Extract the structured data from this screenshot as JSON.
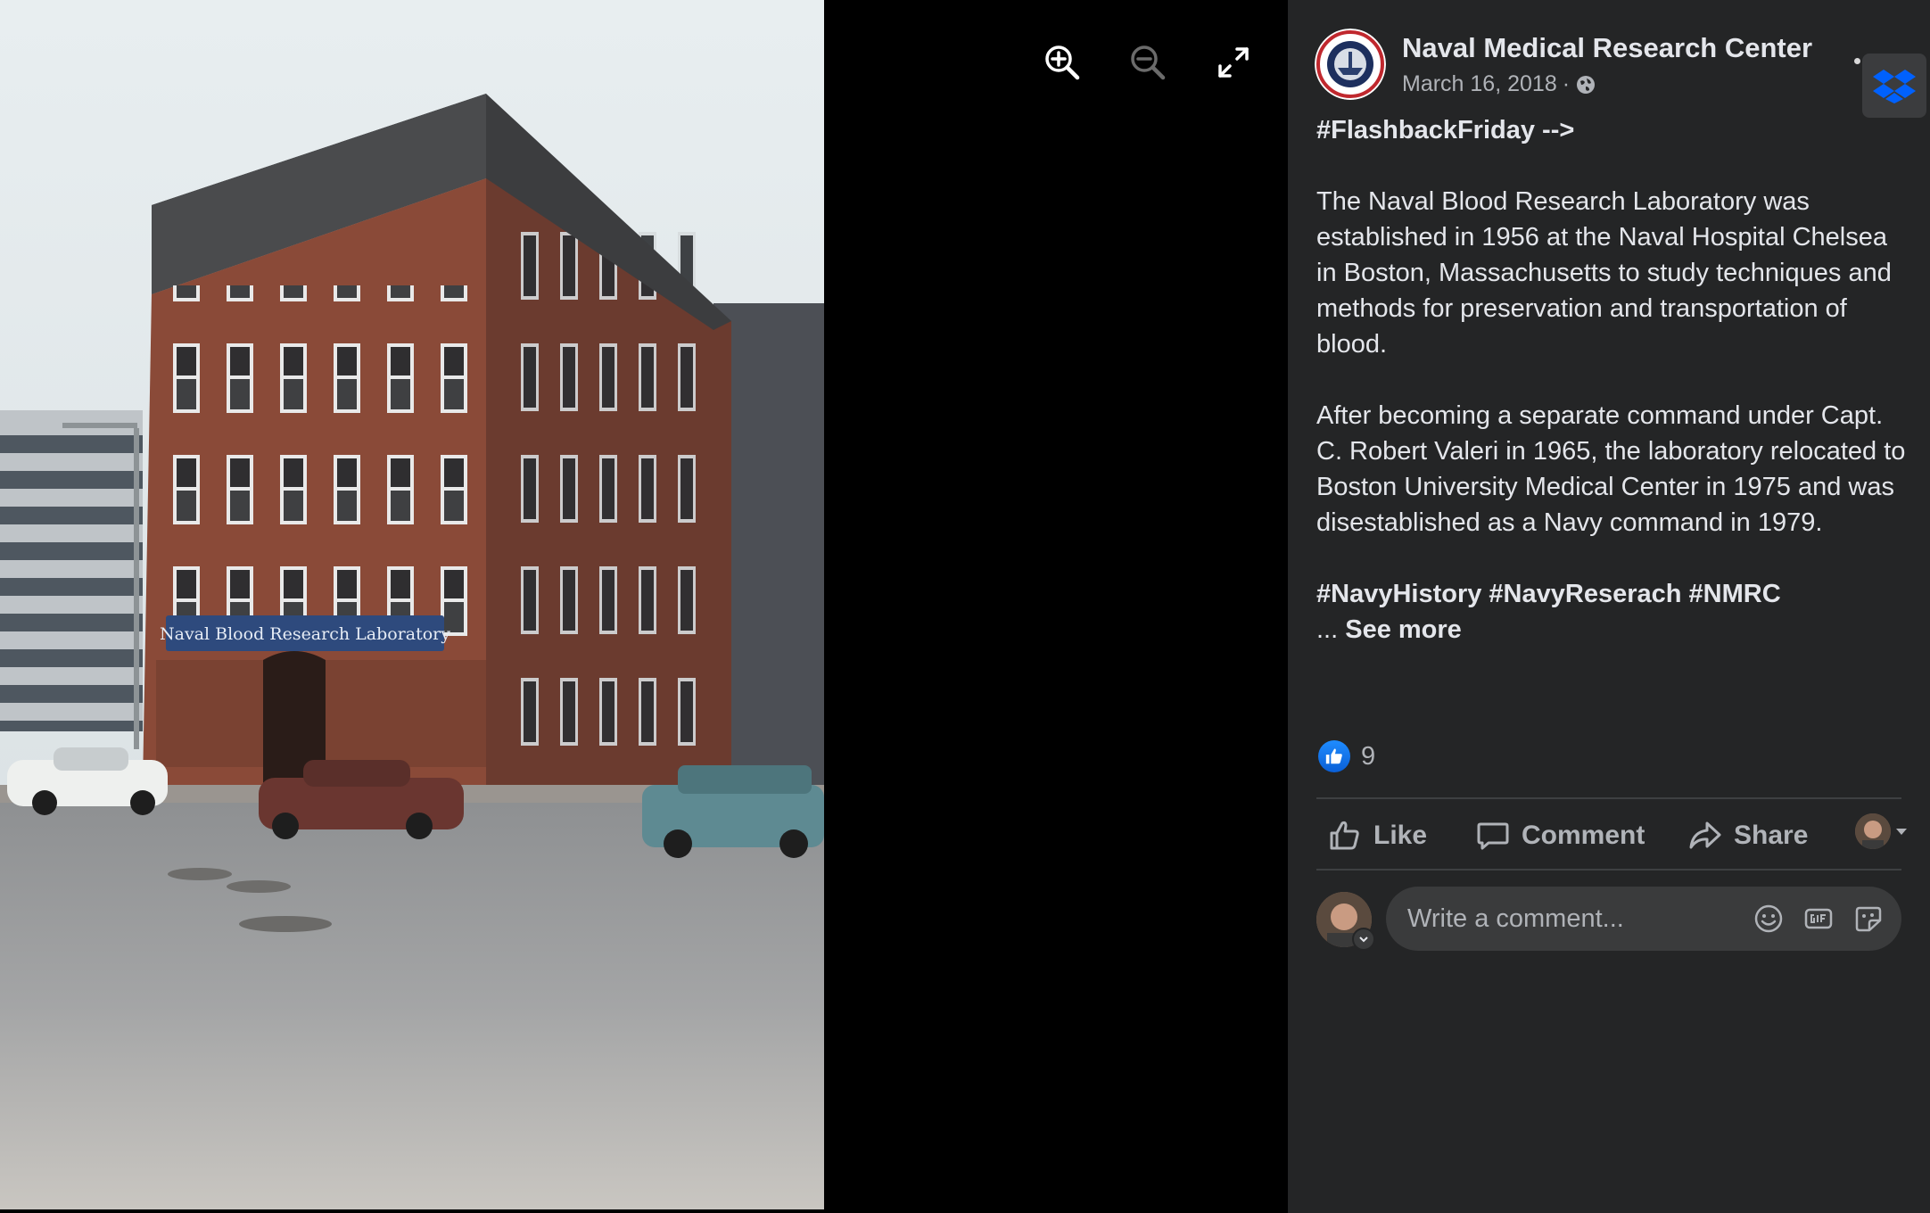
{
  "viewer": {
    "photo_sign_text": "Naval Blood Research Laboratory",
    "zoom_in_icon": "zoom-in-icon",
    "zoom_out_icon": "zoom-out-icon",
    "fullscreen_icon": "expand-icon"
  },
  "post": {
    "page_name": "Naval Medical Research Center",
    "date": "March 16, 2018",
    "separator": "·",
    "audience_icon": "globe-icon",
    "headline": "#FlashbackFriday -->",
    "paragraph_1": "The Naval Blood Research Laboratory was established in 1956 at the Naval Hospital Chelsea in Boston, Massachusetts to study techniques and methods for preservation and transportation of blood.",
    "paragraph_2": "After becoming a separate command under Capt. C. Robert Valeri in 1965, the laboratory relocated to Boston University Medical Center in 1975 and was disestablished as a Navy command in 1979.",
    "hashtags": "#NavyHistory #NavyReserach #NMRC",
    "see_more_prefix": "... ",
    "see_more": "See more",
    "reaction_count": "9"
  },
  "actions": {
    "like": "Like",
    "comment": "Comment",
    "share": "Share"
  },
  "comment_box": {
    "placeholder": "Write a comment...",
    "tools": [
      "emoji-icon",
      "gif-icon",
      "sticker-icon"
    ]
  },
  "colors": {
    "panel_bg": "#242526",
    "text_primary": "#e4e6eb",
    "text_secondary": "#b0b3b8",
    "like_blue": "#1877f2",
    "divider": "#3e4042",
    "input_bg": "#3a3b3c"
  }
}
